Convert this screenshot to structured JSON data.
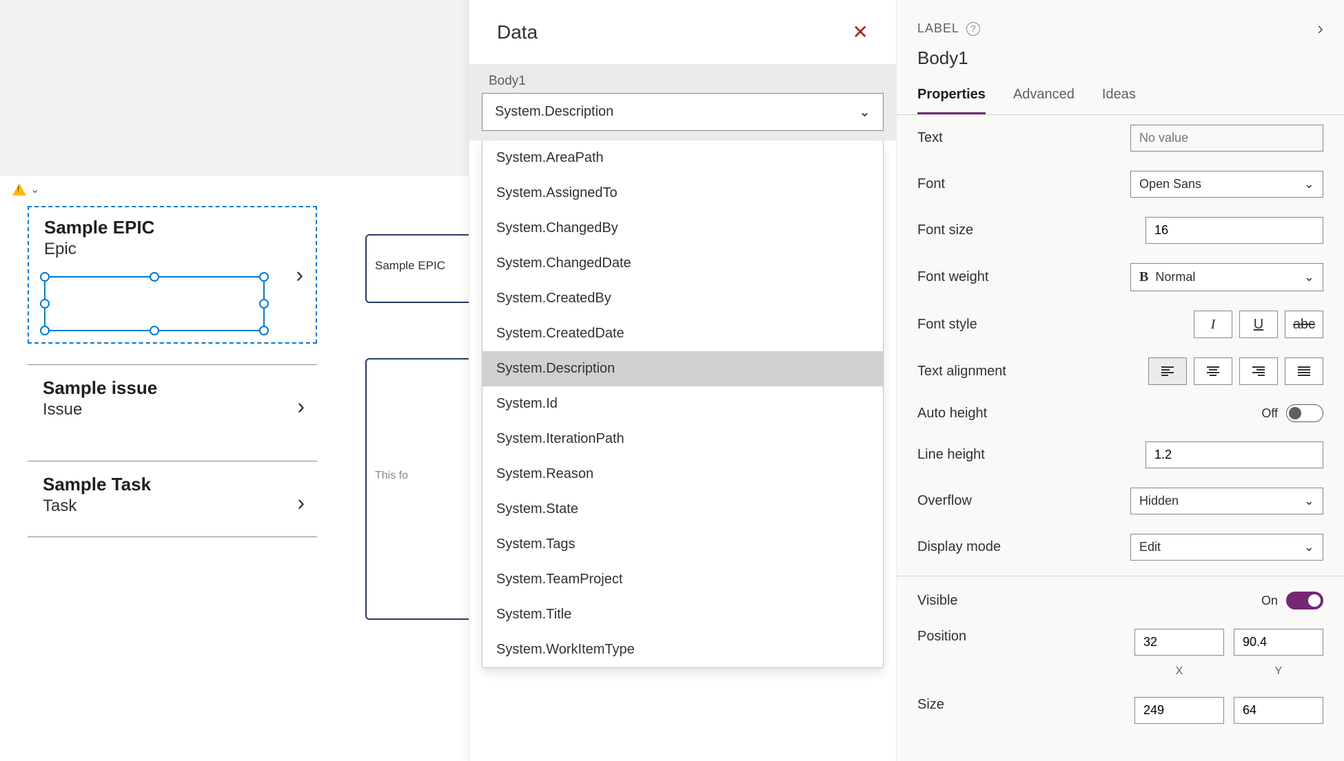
{
  "canvas": {
    "items": [
      {
        "title": "Sample EPIC",
        "subtitle": "Epic"
      },
      {
        "title": "Sample issue",
        "subtitle": "Issue"
      },
      {
        "title": "Sample Task",
        "subtitle": "Task"
      }
    ],
    "detail_title": "Sample EPIC",
    "detail_body_placeholder": "This fo"
  },
  "data_panel": {
    "title": "Data",
    "subject": "Body1",
    "selected_field": "System.Description",
    "options": [
      "System.AreaPath",
      "System.AssignedTo",
      "System.ChangedBy",
      "System.ChangedDate",
      "System.CreatedBy",
      "System.CreatedDate",
      "System.Description",
      "System.Id",
      "System.IterationPath",
      "System.Reason",
      "System.State",
      "System.Tags",
      "System.TeamProject",
      "System.Title",
      "System.WorkItemType"
    ]
  },
  "props": {
    "type_label": "LABEL",
    "control_name": "Body1",
    "tabs": {
      "properties": "Properties",
      "advanced": "Advanced",
      "ideas": "Ideas"
    },
    "text": {
      "label": "Text",
      "placeholder": "No value"
    },
    "font": {
      "label": "Font",
      "value": "Open Sans"
    },
    "font_size": {
      "label": "Font size",
      "value": "16"
    },
    "font_weight": {
      "label": "Font weight",
      "value": "Normal"
    },
    "font_style": {
      "label": "Font style"
    },
    "text_align": {
      "label": "Text alignment"
    },
    "auto_height": {
      "label": "Auto height",
      "state": "Off"
    },
    "line_height": {
      "label": "Line height",
      "value": "1.2"
    },
    "overflow": {
      "label": "Overflow",
      "value": "Hidden"
    },
    "display_mode": {
      "label": "Display mode",
      "value": "Edit"
    },
    "visible": {
      "label": "Visible",
      "state": "On"
    },
    "position": {
      "label": "Position",
      "x": "32",
      "y": "90.4",
      "xlabel": "X",
      "ylabel": "Y"
    },
    "size": {
      "label": "Size",
      "w": "249",
      "h": "64"
    }
  }
}
